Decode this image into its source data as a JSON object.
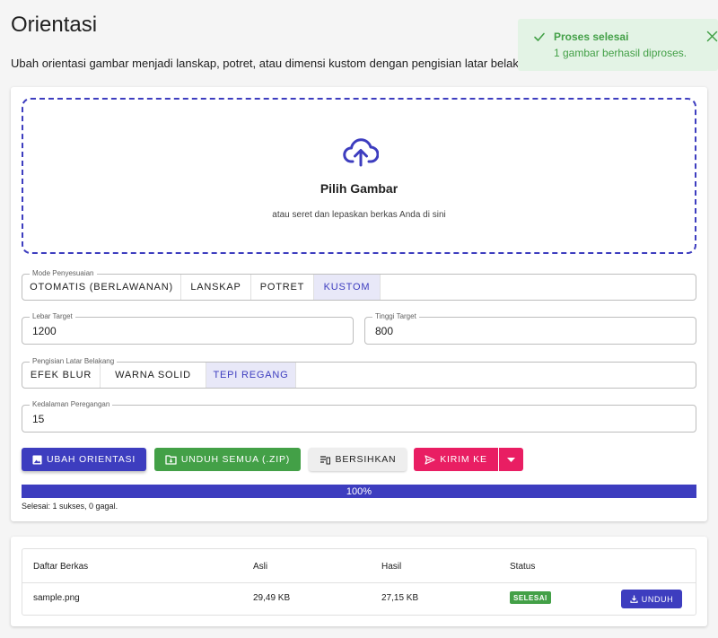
{
  "page": {
    "title": "Orientasi",
    "description": "Ubah orientasi gambar menjadi lanskap, potret, atau dimensi kustom dengan pengisian latar belakang"
  },
  "toast": {
    "title": "Proses selesai",
    "message": "1 gambar berhasil diproses.",
    "color": "#43a047"
  },
  "dropzone": {
    "title": "Pilih Gambar",
    "subtitle": "atau seret dan lepaskan berkas Anda di sini",
    "icon": "cloud-upload-icon"
  },
  "fit_mode": {
    "legend": "Mode Penyesuaian",
    "options": [
      "OTOMATIS (BERLAWANAN)",
      "LANSKAP",
      "POTRET",
      "KUSTOM"
    ],
    "selected": "KUSTOM"
  },
  "target_width": {
    "label": "Lebar Target",
    "value": "1200"
  },
  "target_height": {
    "label": "Tinggi Target",
    "value": "800"
  },
  "fill_mode": {
    "legend": "Pengisian Latar Belakang",
    "options": [
      "EFEK BLUR",
      "WARNA SOLID",
      "TEPI REGANG"
    ],
    "selected": "TEPI REGANG"
  },
  "stretch_depth": {
    "label": "Kedalaman Peregangan",
    "value": "15"
  },
  "actions": {
    "convert": "UBAH ORIENTASI",
    "download_all": "UNDUH SEMUA (.ZIP)",
    "clear": "BERSIHKAN",
    "send_to": "KIRIM KE"
  },
  "progress": {
    "percent": 100,
    "label": "100%",
    "summary": "Selesai: 1 sukses, 0 gagal."
  },
  "files": {
    "columns": [
      "Daftar Berkas",
      "Asli",
      "Hasil",
      "Status"
    ],
    "rows": [
      {
        "name": "sample.png",
        "original": "29,49 KB",
        "result": "27,15 KB",
        "status": "SELESAI",
        "action": "UNDUH"
      }
    ]
  },
  "colors": {
    "primary": "#3d3dbf",
    "success": "#43a047",
    "send": "#e91e63"
  }
}
